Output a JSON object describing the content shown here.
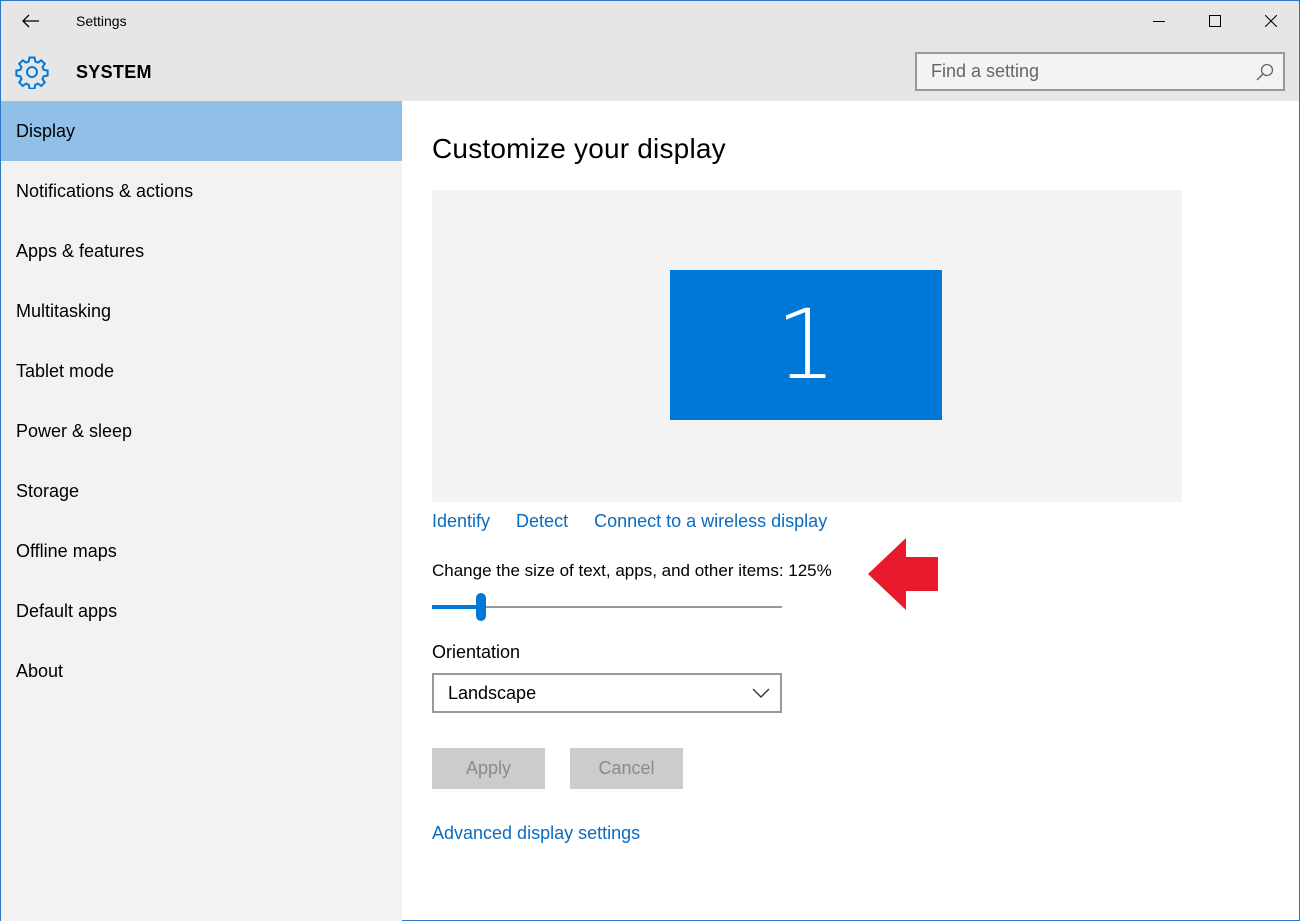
{
  "window": {
    "title": "Settings"
  },
  "header": {
    "section_title": "SYSTEM",
    "search_placeholder": "Find a setting"
  },
  "sidebar": {
    "items": [
      {
        "label": "Display",
        "active": true
      },
      {
        "label": "Notifications & actions",
        "active": false
      },
      {
        "label": "Apps & features",
        "active": false
      },
      {
        "label": "Multitasking",
        "active": false
      },
      {
        "label": "Tablet mode",
        "active": false
      },
      {
        "label": "Power & sleep",
        "active": false
      },
      {
        "label": "Storage",
        "active": false
      },
      {
        "label": "Offline maps",
        "active": false
      },
      {
        "label": "Default apps",
        "active": false
      },
      {
        "label": "About",
        "active": false
      }
    ]
  },
  "main": {
    "page_title": "Customize your display",
    "monitor_number": "1",
    "links": {
      "identify": "Identify",
      "detect": "Detect",
      "connect": "Connect to a wireless display"
    },
    "scale": {
      "label": "Change the size of text, apps, and other items: 125%",
      "slider_fraction": 0.14
    },
    "orientation": {
      "label": "Orientation",
      "selected": "Landscape"
    },
    "buttons": {
      "apply": "Apply",
      "cancel": "Cancel"
    },
    "advanced_link": "Advanced display settings"
  },
  "colors": {
    "accent": "#0078d7",
    "link": "#0a6bbf",
    "sidebar_active": "#90c0e8",
    "annotation_arrow": "#e8192c"
  }
}
